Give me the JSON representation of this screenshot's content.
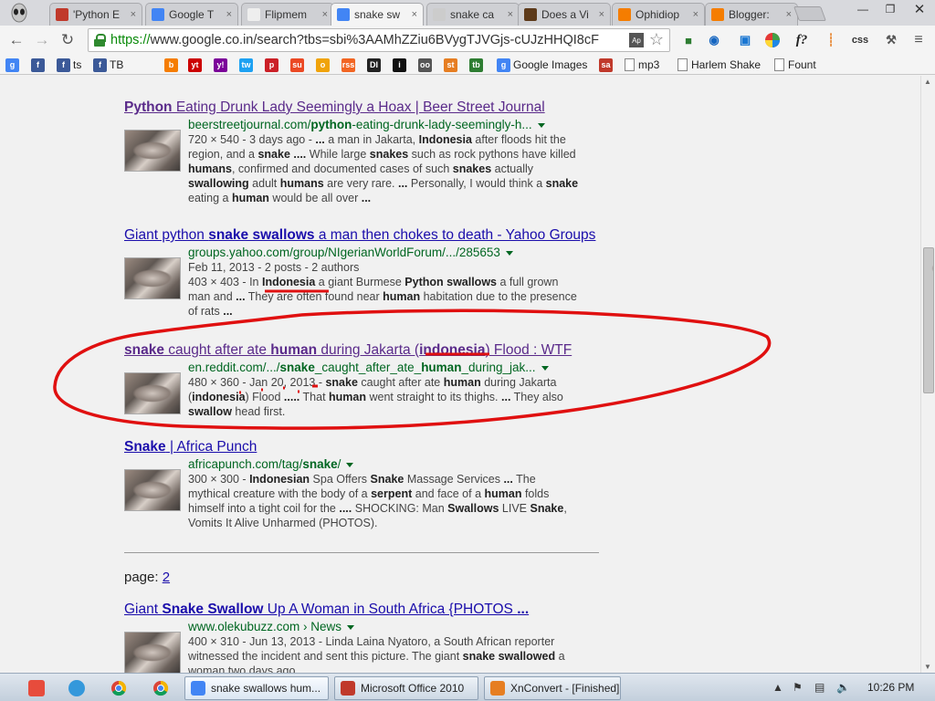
{
  "tabs": [
    {
      "title": "'Python E",
      "color": "#c0392b"
    },
    {
      "title": "Google T",
      "color": "#4285f4"
    },
    {
      "title": "Flipmem",
      "color": "#eeeeee"
    },
    {
      "title": "snake sw",
      "color": "#4285f4",
      "active": true
    },
    {
      "title": "snake ca",
      "color": "#cccccc"
    },
    {
      "title": "Does a Vi",
      "color": "#5d3a1a"
    },
    {
      "title": "Ophidiop",
      "color": "#f57d00"
    },
    {
      "title": "Blogger:",
      "color": "#f57d00"
    }
  ],
  "toolbar": {
    "url_scheme": "https://",
    "url_rest": "www.google.co.in/search?tbs=sbi%3AAMhZZiu6BVygTJVGjs-cUJzHHQI8cF",
    "ap_label": "Ap",
    "ext_labels": [
      "f?",
      "css"
    ]
  },
  "bookmarks": [
    {
      "label": "",
      "icon": "g",
      "color": "#4285f4"
    },
    {
      "label": "",
      "icon": "f",
      "color": "#3b5998"
    },
    {
      "label": "ts",
      "icon": "f",
      "color": "#3b5998"
    },
    {
      "label": "TB",
      "icon": "f",
      "color": "#3b5998"
    },
    {
      "label": "",
      "icon": "b",
      "color": "#f57d00"
    },
    {
      "label": "",
      "icon": "yt",
      "color": "#cc0000"
    },
    {
      "label": "",
      "icon": "y!",
      "color": "#7b0099"
    },
    {
      "label": "",
      "icon": "tw",
      "color": "#1da1f2"
    },
    {
      "label": "",
      "icon": "p",
      "color": "#cb2027"
    },
    {
      "label": "",
      "icon": "su",
      "color": "#eb4924"
    },
    {
      "label": "",
      "icon": "o",
      "color": "#f0a30a"
    },
    {
      "label": "",
      "icon": "rss",
      "color": "#f26522"
    },
    {
      "label": "",
      "icon": "DI",
      "color": "#222222"
    },
    {
      "label": "",
      "icon": "i",
      "color": "#111111"
    },
    {
      "label": "",
      "icon": "oo",
      "color": "#555555"
    },
    {
      "label": "",
      "icon": "st",
      "color": "#e67e22"
    },
    {
      "label": "",
      "icon": "tb",
      "color": "#2e7d32"
    },
    {
      "label": "Google Images",
      "icon": "g",
      "color": "#4285f4"
    },
    {
      "label": "",
      "icon": "sa",
      "color": "#c0392b"
    },
    {
      "label": "mp3",
      "icon": "page",
      "color": "#ffffff"
    },
    {
      "label": "Harlem Shake",
      "icon": "page",
      "color": "#ffffff"
    },
    {
      "label": "Fount",
      "icon": "page",
      "color": "#ffffff"
    }
  ],
  "results": [
    {
      "title": [
        {
          "t": "Python",
          "b": true
        },
        {
          "t": " Eating Drunk Lady Seemingly a Hoax | Beer Street Journal",
          "b": false
        }
      ],
      "url": [
        {
          "t": "beerstreetjournal.com/",
          "b": false
        },
        {
          "t": "python",
          "b": true
        },
        {
          "t": "-eating-drunk-lady-seemingly-h...",
          "b": false
        }
      ],
      "visited": true,
      "lines": [
        [
          {
            "t": "720 × 540 - 3 days ago - ",
            "b": false
          },
          {
            "t": "...",
            "b": true
          },
          {
            "t": " a man in Jakarta, ",
            "b": false
          },
          {
            "t": "Indonesia",
            "b": true
          },
          {
            "t": " after floods hit the",
            "b": false
          }
        ],
        [
          {
            "t": "region, and a ",
            "b": false
          },
          {
            "t": "snake",
            "b": true
          },
          {
            "t": " ",
            "b": false
          },
          {
            "t": "....",
            "b": true
          },
          {
            "t": " While large ",
            "b": false
          },
          {
            "t": "snakes",
            "b": true
          },
          {
            "t": " such as rock pythons have killed",
            "b": false
          }
        ],
        [
          {
            "t": "humans",
            "b": true
          },
          {
            "t": ", confirmed and documented cases of such ",
            "b": false
          },
          {
            "t": "snakes",
            "b": true
          },
          {
            "t": " actually",
            "b": false
          }
        ],
        [
          {
            "t": "swallowing",
            "b": true
          },
          {
            "t": " adult ",
            "b": false
          },
          {
            "t": "humans",
            "b": true
          },
          {
            "t": " are very rare. ",
            "b": false
          },
          {
            "t": "...",
            "b": true
          },
          {
            "t": " Personally, I would think a ",
            "b": false
          },
          {
            "t": "snake",
            "b": true
          }
        ],
        [
          {
            "t": "eating a ",
            "b": false
          },
          {
            "t": "human",
            "b": true
          },
          {
            "t": " would be all over ",
            "b": false
          },
          {
            "t": "...",
            "b": true
          }
        ]
      ]
    },
    {
      "title": [
        {
          "t": "Giant python ",
          "b": false
        },
        {
          "t": "snake swallows",
          "b": true
        },
        {
          "t": " a man then chokes to death - Yahoo Groups",
          "b": false
        }
      ],
      "url": [
        {
          "t": "groups.yahoo.com/group/NIgerianWorldForum/.../285653",
          "b": false
        }
      ],
      "visited": false,
      "lines": [
        [
          {
            "t": "Feb 11, 2013 - 2 posts - 2 authors",
            "b": false
          }
        ],
        [
          {
            "t": "403 × 403 - In ",
            "b": false
          },
          {
            "t": "Indonesia",
            "b": true
          },
          {
            "t": " a giant Burmese ",
            "b": false
          },
          {
            "t": "Python swallows",
            "b": true
          },
          {
            "t": " a full grown",
            "b": false
          }
        ],
        [
          {
            "t": "man and ",
            "b": false
          },
          {
            "t": "...",
            "b": true
          },
          {
            "t": " They are often found near ",
            "b": false
          },
          {
            "t": "human",
            "b": true
          },
          {
            "t": " habitation due to the presence",
            "b": false
          }
        ],
        [
          {
            "t": "of rats ",
            "b": false
          },
          {
            "t": "...",
            "b": true
          }
        ]
      ]
    },
    {
      "title": [
        {
          "t": "snake",
          "b": true
        },
        {
          "t": " caught after ate ",
          "b": false
        },
        {
          "t": "human",
          "b": true
        },
        {
          "t": " during Jakarta (",
          "b": false
        },
        {
          "t": "indonesia",
          "b": true
        },
        {
          "t": ") Flood : WTF",
          "b": false
        }
      ],
      "url": [
        {
          "t": "en.reddit.com/.../",
          "b": false
        },
        {
          "t": "snake",
          "b": true
        },
        {
          "t": "_caught_after_ate_",
          "b": false
        },
        {
          "t": "human",
          "b": true
        },
        {
          "t": "_during_jak...",
          "b": false
        }
      ],
      "visited": true,
      "lines": [
        [
          {
            "t": "480 × 360 - Jan 20, 2013 - ",
            "b": false
          },
          {
            "t": "snake",
            "b": true
          },
          {
            "t": " caught after ate ",
            "b": false
          },
          {
            "t": "human",
            "b": true
          },
          {
            "t": " during Jakarta",
            "b": false
          }
        ],
        [
          {
            "t": "(",
            "b": false
          },
          {
            "t": "indonesia",
            "b": true
          },
          {
            "t": ") Flood ",
            "b": false
          },
          {
            "t": ".....",
            "b": true
          },
          {
            "t": " That ",
            "b": false
          },
          {
            "t": "human",
            "b": true
          },
          {
            "t": " went straight to its thighs. ",
            "b": false
          },
          {
            "t": "...",
            "b": true
          },
          {
            "t": " They also",
            "b": false
          }
        ],
        [
          {
            "t": "swallow",
            "b": true
          },
          {
            "t": " head first.",
            "b": false
          }
        ]
      ]
    },
    {
      "title": [
        {
          "t": "Snake",
          "b": true
        },
        {
          "t": " | Africa Punch",
          "b": false
        }
      ],
      "url": [
        {
          "t": "africapunch.com/tag/",
          "b": false
        },
        {
          "t": "snake",
          "b": true
        },
        {
          "t": "/",
          "b": false
        }
      ],
      "visited": false,
      "lines": [
        [
          {
            "t": "300 × 300 - ",
            "b": false
          },
          {
            "t": "Indonesian",
            "b": true
          },
          {
            "t": " Spa Offers ",
            "b": false
          },
          {
            "t": "Snake",
            "b": true
          },
          {
            "t": " Massage Services ",
            "b": false
          },
          {
            "t": "...",
            "b": true
          },
          {
            "t": " The",
            "b": false
          }
        ],
        [
          {
            "t": "mythical creature with the body of a ",
            "b": false
          },
          {
            "t": "serpent",
            "b": true
          },
          {
            "t": " and face of a ",
            "b": false
          },
          {
            "t": "human",
            "b": true
          },
          {
            "t": " folds",
            "b": false
          }
        ],
        [
          {
            "t": "himself into a tight coil for the ",
            "b": false
          },
          {
            "t": "....",
            "b": true
          },
          {
            "t": " SHOCKING: Man ",
            "b": false
          },
          {
            "t": "Swallows",
            "b": true
          },
          {
            "t": " LIVE ",
            "b": false
          },
          {
            "t": "Snake",
            "b": true
          },
          {
            "t": ",",
            "b": false
          }
        ],
        [
          {
            "t": "Vomits It Alive Unharmed (PHOTOS).",
            "b": false
          }
        ]
      ]
    },
    {
      "title": [
        {
          "t": "Giant ",
          "b": false
        },
        {
          "t": "Snake Swallow",
          "b": true
        },
        {
          "t": " Up A Woman in South Africa {PHOTOS ",
          "b": false
        },
        {
          "t": "...",
          "b": true
        }
      ],
      "url": [
        {
          "t": "www.olekubuzz.com › News",
          "b": false
        }
      ],
      "visited": false,
      "lines": [
        [
          {
            "t": "400 × 310 - Jun 13, 2013 - Linda Laina Nyatoro, a South African reporter",
            "b": false
          }
        ],
        [
          {
            "t": "witnessed the incident and sent this picture. The giant ",
            "b": false
          },
          {
            "t": "snake swallowed",
            "b": true
          },
          {
            "t": " a",
            "b": false
          }
        ],
        [
          {
            "t": "woman two days ago",
            "b": false
          }
        ]
      ]
    }
  ],
  "pager": {
    "label": "page: ",
    "page": "2"
  },
  "taskbar": {
    "tasks": [
      {
        "label": "snake swallows hum...",
        "color": "#4285f4",
        "active": true
      },
      {
        "label": "Microsoft Office 2010",
        "color": "#c0392b"
      },
      {
        "label": "XnConvert - [Finished]",
        "color": "#e67e22"
      }
    ],
    "clock": "10:26 PM"
  }
}
